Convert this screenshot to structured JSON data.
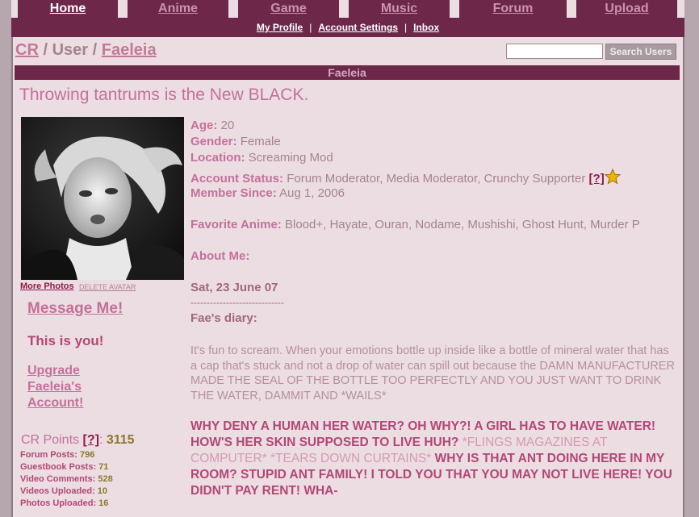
{
  "nav": {
    "tabs": [
      {
        "label": "Home",
        "active": true
      },
      {
        "label": "Anime",
        "active": false
      },
      {
        "label": "Game",
        "active": false
      },
      {
        "label": "Music",
        "active": false
      },
      {
        "label": "Forum",
        "active": false
      },
      {
        "label": "Upload",
        "active": false
      }
    ],
    "sub": {
      "profile": "My Profile",
      "settings": "Account Settings",
      "inbox": "Inbox",
      "sep": "|"
    }
  },
  "breadcrumb": {
    "root": "CR",
    "sep": "/",
    "section": "User",
    "user": "Faeleia"
  },
  "search": {
    "placeholder": "",
    "button": "Search Users"
  },
  "user_bar": "Faeleia",
  "tagline": "Throwing tantrums is the New BLACK.",
  "sidebar": {
    "more_photos": "More Photos",
    "delete_avatar": "DELETE AVATAR",
    "message_me": "Message Me!",
    "this_is_you": "This is you!",
    "upgrade": [
      "Upgrade",
      "Faeleia's",
      "Account!"
    ],
    "points_label": "CR Points",
    "points_help": "[?]",
    "points_sep": ":",
    "points_value": "3115",
    "stats": [
      {
        "label": "Forum Posts:",
        "value": "796"
      },
      {
        "label": "Guestbook Posts:",
        "value": "71"
      },
      {
        "label": "Video Comments:",
        "value": "528"
      },
      {
        "label": "Videos Uploaded:",
        "value": "10"
      },
      {
        "label": "Photos Uploaded:",
        "value": "16"
      }
    ]
  },
  "profile": {
    "age_label": "Age:",
    "age": "20",
    "gender_label": "Gender:",
    "gender": "Female",
    "location_label": "Location:",
    "location": "Screaming Mod",
    "status_label": "Account Status:",
    "status": "Forum Moderator, Media Moderator, Crunchy Supporter",
    "status_help": "[?]",
    "since_label": "Member Since:",
    "since": "Aug 1, 2006",
    "anime_label": "Favorite Anime:",
    "anime": "Blood+, Hayate, Ouran, Nodame, Mushishi, Ghost Hunt, Murder P",
    "about_label": "About Me:"
  },
  "diary": {
    "date": "Sat, 23 June 07",
    "dashes": "-----------------------------",
    "title": "Fae's diary:",
    "para1": "It's fun to scream. When your emotions bottle up inside like a bottle of mineral water that has a cap that's stuck and not a drop of water can spill out because the DAMN MANUFACTURER MADE THE SEAL OF THE BOTTLE TOO PERFECTLY AND YOU JUST WANT TO DRINK THE WATER, DAMMIT AND *WAILS*",
    "para2_a": "WHY DENY A HUMAN HER WATER? OH WHY?! A GIRL HAS TO HAVE WATER! HOW'S HER SKIN SUPPOSED TO LIVE HUH? ",
    "para2_b": "*FLINGS MAGAZINES AT COMPUTER*",
    "para2_c": " ",
    "para2_d": "*TEARS DOWN CURTAINS*",
    "para2_e": " WHY IS THAT ANT DOING HERE IN MY ROOM? STUPID ANT FAMILY! I TOLD YOU THAT YOU MAY NOT LIVE HERE! YOU DIDN'T PAY RENT! WHA-"
  },
  "colors": {
    "accent": "#6c2749",
    "pink": "#c4709a",
    "panel": "#ecdde3"
  }
}
